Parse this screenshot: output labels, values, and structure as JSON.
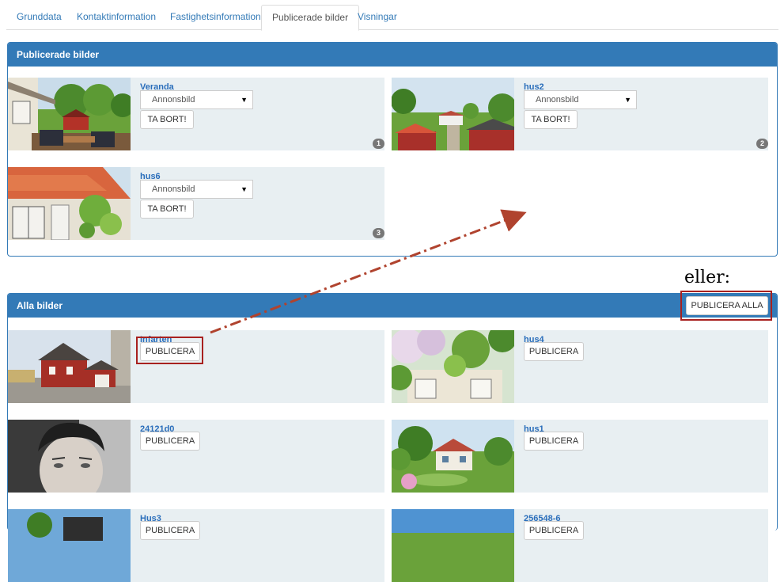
{
  "tabs": [
    {
      "label": "Grunddata"
    },
    {
      "label": "Kontaktinformation"
    },
    {
      "label": "Fastighetsinformation"
    },
    {
      "label": "Publicerade bilder",
      "active": true
    },
    {
      "label": "Visningar"
    }
  ],
  "published_panel": {
    "title": "Publicerade bilder",
    "items": [
      {
        "title": "Veranda",
        "select_value": "Annonsbild",
        "remove_label": "TA BORT!",
        "badge": "1"
      },
      {
        "title": "hus2",
        "select_value": "Annonsbild",
        "remove_label": "TA BORT!",
        "badge": "2"
      },
      {
        "title": "hus6",
        "select_value": "Annonsbild",
        "remove_label": "TA BORT!",
        "badge": "3"
      }
    ]
  },
  "annotation": {
    "eller": "eller:",
    "arrow_color": "#b0432e",
    "highlight_color": "#a8211f"
  },
  "all_panel": {
    "title": "Alla bilder",
    "publish_all_label": "PUBLICERA ALLA",
    "items": [
      {
        "title": "Infarten",
        "publish_label": "PUBLICERA"
      },
      {
        "title": "hus4",
        "publish_label": "PUBLICERA"
      },
      {
        "title": "24121d0",
        "publish_label": "PUBLICERA"
      },
      {
        "title": "hus1",
        "publish_label": "PUBLICERA"
      },
      {
        "title": "Hus3",
        "publish_label": "PUBLICERA"
      },
      {
        "title": "256548-6",
        "publish_label": "PUBLICERA"
      }
    ]
  },
  "colors": {
    "primary": "#337ab7",
    "card_bg": "#e8eff2",
    "link": "#2a6ebb"
  }
}
